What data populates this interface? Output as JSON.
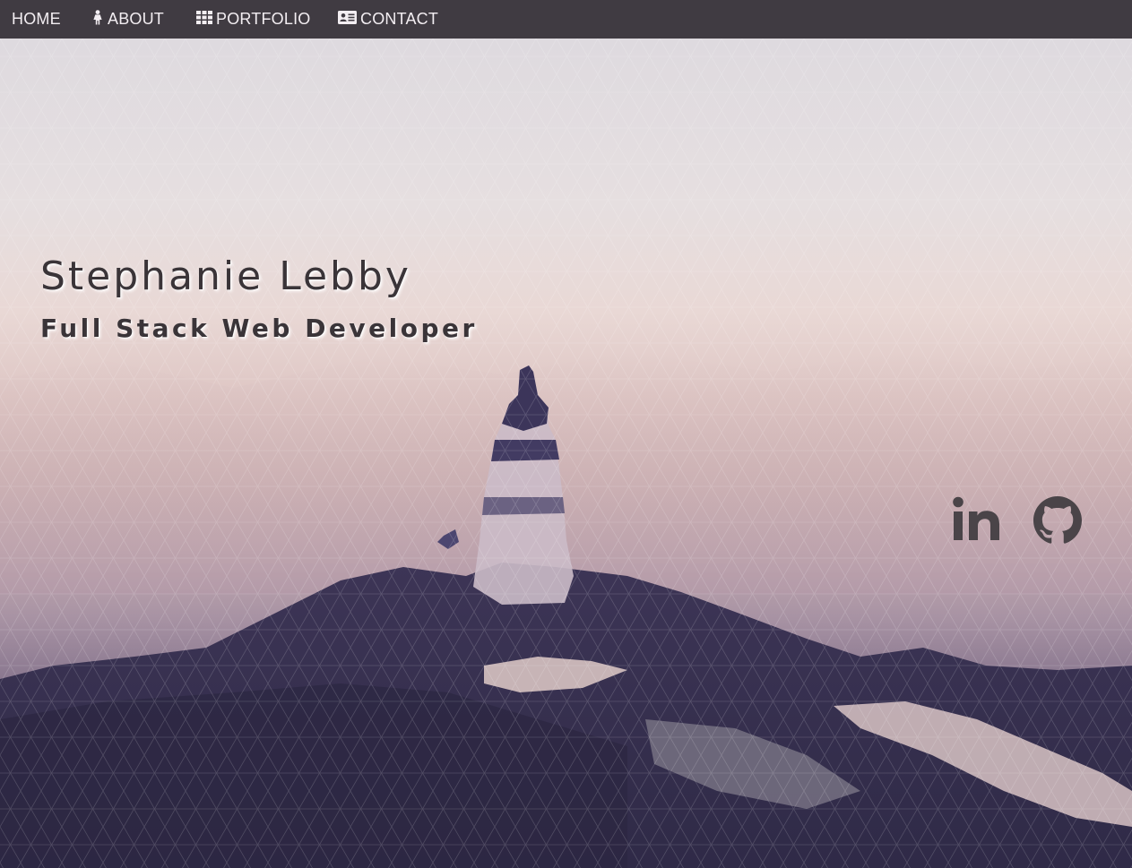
{
  "nav": {
    "items": [
      {
        "label": "HOME",
        "icon": ""
      },
      {
        "label": "ABOUT",
        "icon": "female-icon"
      },
      {
        "label": "PORTFOLIO",
        "icon": "grid-icon"
      },
      {
        "label": "CONTACT",
        "icon": "address-card-icon"
      }
    ]
  },
  "hero": {
    "name": "Stephanie Lebby",
    "title": "Full Stack Web Developer"
  },
  "social": {
    "linkedin_icon": "linkedin-icon",
    "github_icon": "github-icon"
  },
  "colors": {
    "navbar": "#403b42",
    "nav_text": "#f3eef2",
    "heading_text": "#3a3438",
    "icon_color": "#4a4448",
    "sky_top": "#dedadf",
    "sky_pink": "#e9d8d5",
    "land_dark": "#3b3455"
  }
}
